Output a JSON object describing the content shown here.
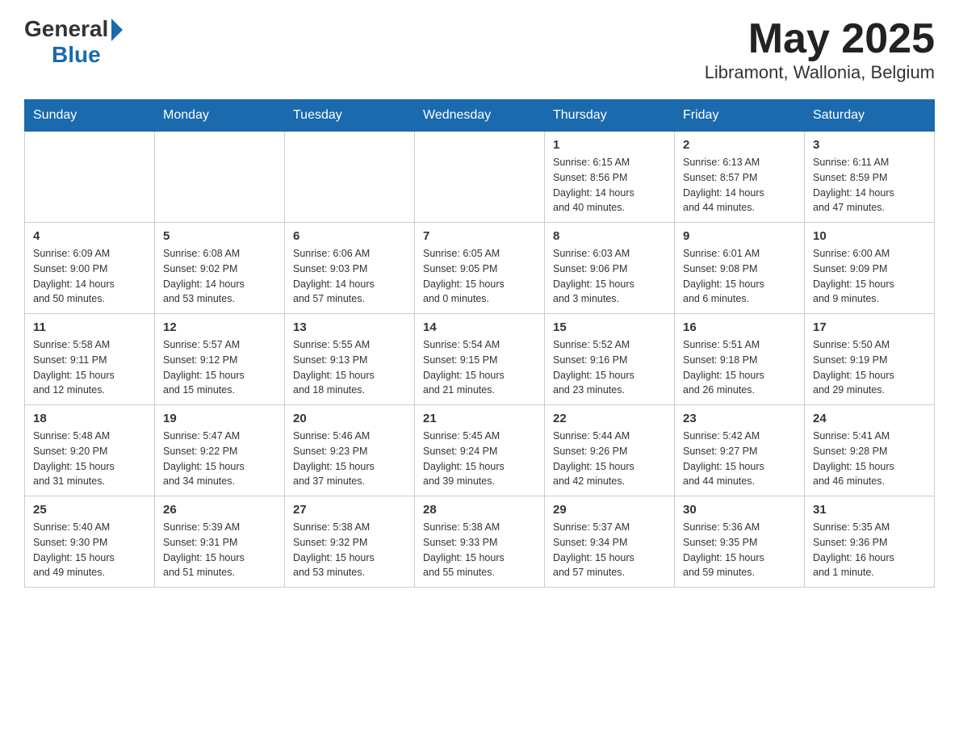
{
  "header": {
    "logo_general": "General",
    "logo_blue": "Blue",
    "month": "May 2025",
    "location": "Libramont, Wallonia, Belgium"
  },
  "weekdays": [
    "Sunday",
    "Monday",
    "Tuesday",
    "Wednesday",
    "Thursday",
    "Friday",
    "Saturday"
  ],
  "weeks": [
    [
      {
        "day": "",
        "info": ""
      },
      {
        "day": "",
        "info": ""
      },
      {
        "day": "",
        "info": ""
      },
      {
        "day": "",
        "info": ""
      },
      {
        "day": "1",
        "info": "Sunrise: 6:15 AM\nSunset: 8:56 PM\nDaylight: 14 hours\nand 40 minutes."
      },
      {
        "day": "2",
        "info": "Sunrise: 6:13 AM\nSunset: 8:57 PM\nDaylight: 14 hours\nand 44 minutes."
      },
      {
        "day": "3",
        "info": "Sunrise: 6:11 AM\nSunset: 8:59 PM\nDaylight: 14 hours\nand 47 minutes."
      }
    ],
    [
      {
        "day": "4",
        "info": "Sunrise: 6:09 AM\nSunset: 9:00 PM\nDaylight: 14 hours\nand 50 minutes."
      },
      {
        "day": "5",
        "info": "Sunrise: 6:08 AM\nSunset: 9:02 PM\nDaylight: 14 hours\nand 53 minutes."
      },
      {
        "day": "6",
        "info": "Sunrise: 6:06 AM\nSunset: 9:03 PM\nDaylight: 14 hours\nand 57 minutes."
      },
      {
        "day": "7",
        "info": "Sunrise: 6:05 AM\nSunset: 9:05 PM\nDaylight: 15 hours\nand 0 minutes."
      },
      {
        "day": "8",
        "info": "Sunrise: 6:03 AM\nSunset: 9:06 PM\nDaylight: 15 hours\nand 3 minutes."
      },
      {
        "day": "9",
        "info": "Sunrise: 6:01 AM\nSunset: 9:08 PM\nDaylight: 15 hours\nand 6 minutes."
      },
      {
        "day": "10",
        "info": "Sunrise: 6:00 AM\nSunset: 9:09 PM\nDaylight: 15 hours\nand 9 minutes."
      }
    ],
    [
      {
        "day": "11",
        "info": "Sunrise: 5:58 AM\nSunset: 9:11 PM\nDaylight: 15 hours\nand 12 minutes."
      },
      {
        "day": "12",
        "info": "Sunrise: 5:57 AM\nSunset: 9:12 PM\nDaylight: 15 hours\nand 15 minutes."
      },
      {
        "day": "13",
        "info": "Sunrise: 5:55 AM\nSunset: 9:13 PM\nDaylight: 15 hours\nand 18 minutes."
      },
      {
        "day": "14",
        "info": "Sunrise: 5:54 AM\nSunset: 9:15 PM\nDaylight: 15 hours\nand 21 minutes."
      },
      {
        "day": "15",
        "info": "Sunrise: 5:52 AM\nSunset: 9:16 PM\nDaylight: 15 hours\nand 23 minutes."
      },
      {
        "day": "16",
        "info": "Sunrise: 5:51 AM\nSunset: 9:18 PM\nDaylight: 15 hours\nand 26 minutes."
      },
      {
        "day": "17",
        "info": "Sunrise: 5:50 AM\nSunset: 9:19 PM\nDaylight: 15 hours\nand 29 minutes."
      }
    ],
    [
      {
        "day": "18",
        "info": "Sunrise: 5:48 AM\nSunset: 9:20 PM\nDaylight: 15 hours\nand 31 minutes."
      },
      {
        "day": "19",
        "info": "Sunrise: 5:47 AM\nSunset: 9:22 PM\nDaylight: 15 hours\nand 34 minutes."
      },
      {
        "day": "20",
        "info": "Sunrise: 5:46 AM\nSunset: 9:23 PM\nDaylight: 15 hours\nand 37 minutes."
      },
      {
        "day": "21",
        "info": "Sunrise: 5:45 AM\nSunset: 9:24 PM\nDaylight: 15 hours\nand 39 minutes."
      },
      {
        "day": "22",
        "info": "Sunrise: 5:44 AM\nSunset: 9:26 PM\nDaylight: 15 hours\nand 42 minutes."
      },
      {
        "day": "23",
        "info": "Sunrise: 5:42 AM\nSunset: 9:27 PM\nDaylight: 15 hours\nand 44 minutes."
      },
      {
        "day": "24",
        "info": "Sunrise: 5:41 AM\nSunset: 9:28 PM\nDaylight: 15 hours\nand 46 minutes."
      }
    ],
    [
      {
        "day": "25",
        "info": "Sunrise: 5:40 AM\nSunset: 9:30 PM\nDaylight: 15 hours\nand 49 minutes."
      },
      {
        "day": "26",
        "info": "Sunrise: 5:39 AM\nSunset: 9:31 PM\nDaylight: 15 hours\nand 51 minutes."
      },
      {
        "day": "27",
        "info": "Sunrise: 5:38 AM\nSunset: 9:32 PM\nDaylight: 15 hours\nand 53 minutes."
      },
      {
        "day": "28",
        "info": "Sunrise: 5:38 AM\nSunset: 9:33 PM\nDaylight: 15 hours\nand 55 minutes."
      },
      {
        "day": "29",
        "info": "Sunrise: 5:37 AM\nSunset: 9:34 PM\nDaylight: 15 hours\nand 57 minutes."
      },
      {
        "day": "30",
        "info": "Sunrise: 5:36 AM\nSunset: 9:35 PM\nDaylight: 15 hours\nand 59 minutes."
      },
      {
        "day": "31",
        "info": "Sunrise: 5:35 AM\nSunset: 9:36 PM\nDaylight: 16 hours\nand 1 minute."
      }
    ]
  ]
}
